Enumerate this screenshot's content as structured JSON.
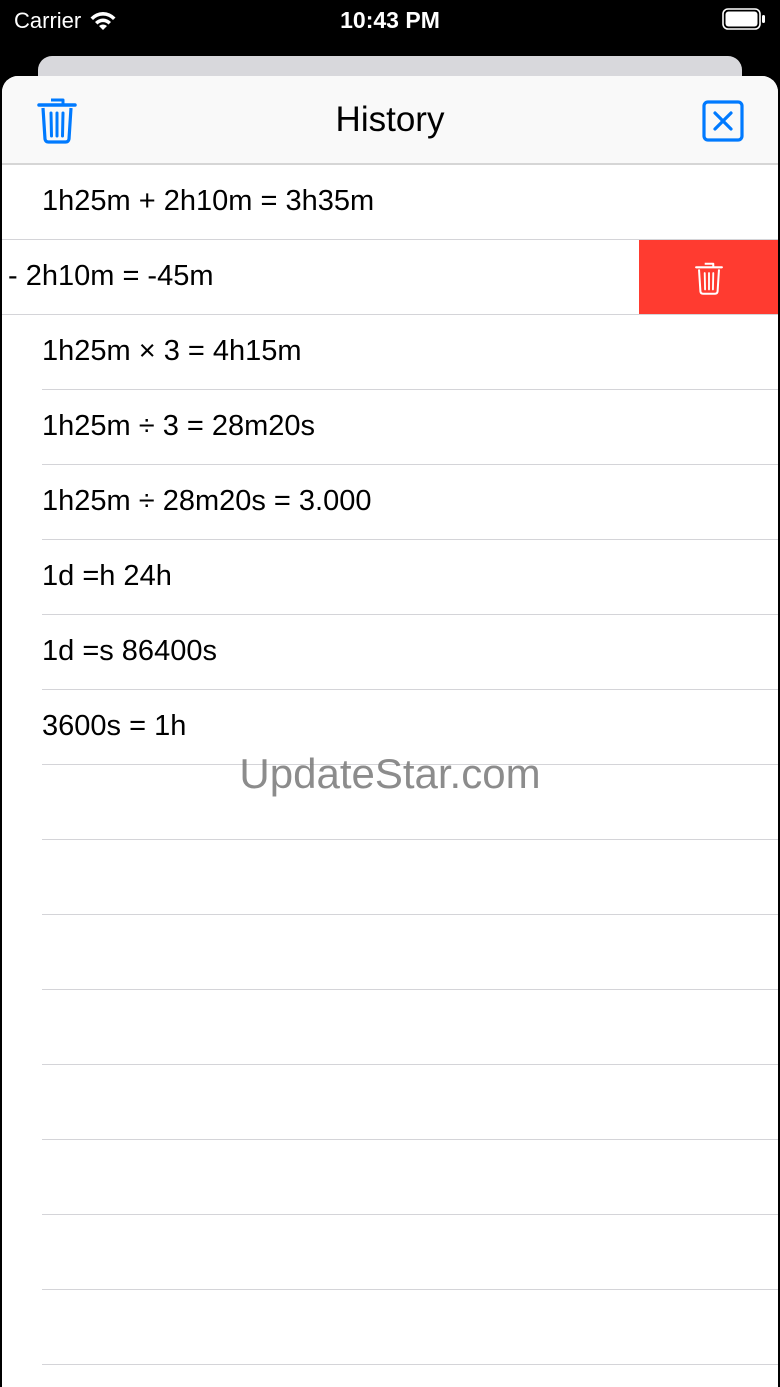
{
  "status_bar": {
    "carrier": "Carrier",
    "time": "10:43 PM"
  },
  "navbar": {
    "title": "History",
    "left_icon": "trash-icon",
    "right_icon": "close-box-icon",
    "accent_color": "#007aff"
  },
  "history": {
    "items": [
      "1h25m + 2h10m = 3h35m",
      "- 2h10m = -45m",
      "1h25m × 3 = 4h15m",
      "1h25m ÷ 3 = 28m20s",
      "1h25m ÷ 28m20s = 3.000",
      "1d =h 24h",
      "1d =s 86400s",
      "3600s = 1h"
    ],
    "swiped_index": 1,
    "delete_action_icon": "trash-icon",
    "delete_color": "#ff3b30"
  },
  "watermark": "UpdateStar.com"
}
